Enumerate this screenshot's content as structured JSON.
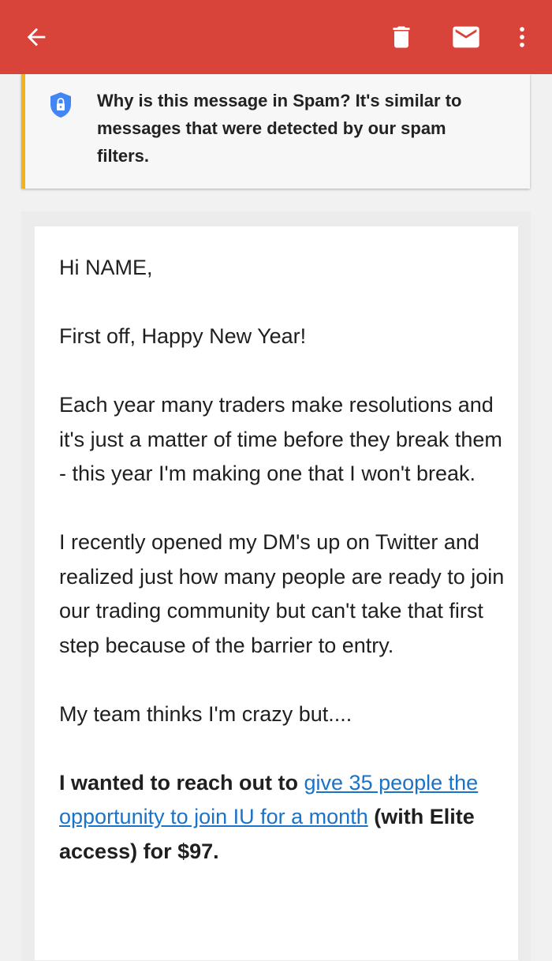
{
  "app_bar": {
    "background": "#d9443a",
    "icons": [
      "back-arrow-icon",
      "trash-icon",
      "mail-icon",
      "more-vert-icon"
    ]
  },
  "spam_notice": {
    "accent_color": "#f2b318",
    "icon": "shield-lock-icon",
    "text": "Why is this message in Spam? It's similar to messages that were detected by our spam filters."
  },
  "email": {
    "greeting": "Hi NAME,",
    "p1": "First off, Happy New Year!",
    "p2": "Each year many traders make resolutions and it's just a matter of time before they break them - this year I'm making one that I won't break.",
    "p3": "I recently opened my DM's up on Twitter and realized just how many people are ready to join our trading community but can't take that first step because of the barrier to entry.",
    "p4": "My team thinks I'm crazy but....",
    "p5_prefix": "I wanted to reach out to ",
    "p5_link": "give 35 people the opportunity to join IU for a month",
    "p5_suffix": " (with Elite access) for $97.",
    "link_color": "#1a73c8"
  }
}
